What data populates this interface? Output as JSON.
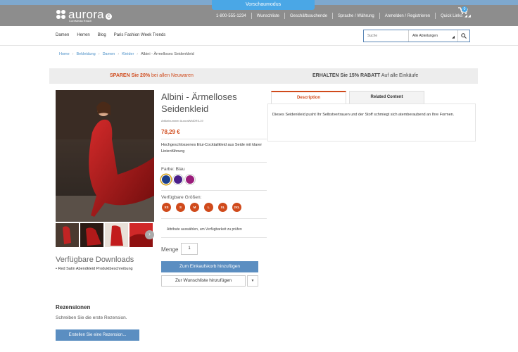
{
  "preview_bar": {
    "label": "Vorschaumodus"
  },
  "header": {
    "logo_text": "aurora",
    "logo_sub": "CoreMedia Reach",
    "phone": "1-800-555-1234",
    "links": [
      "Wunschliste",
      "Geschäftssuchende",
      "Sprache / Währung",
      "Anmelden / Registrieren",
      "Quick Links"
    ],
    "cart_count": "0"
  },
  "nav": {
    "items": [
      "Damen",
      "Herren",
      "Blog",
      "Paris Fashion Week Trends"
    ],
    "search_placeholder": "Suche",
    "department": "Alle Abteilungen"
  },
  "breadcrumb": [
    "Home",
    "Bekleidung",
    "Damen",
    "Kleider",
    "Albini - Ärmelloses Seidenkleid"
  ],
  "promo": {
    "left_bold": "SPAREN Sie 20%",
    "left_rest": " bei allen Neuwaren",
    "right_bold": "ERHALTEN Sie 15% RABATT",
    "right_rest": " Auf alle Einkäufe"
  },
  "product": {
    "name": "Albini - Ärmelloses Seidenkleid",
    "sku": "Artikelnummer AuroraWMDR5-19",
    "price": "78,29 €",
    "short_desc": "Hochgeschlossenes Etui-Cocktailkleid aus Seide mit klarer Linienführung",
    "color_label": "Farbe: Blau",
    "colors": [
      "#1c3f8c",
      "#4a1f8a",
      "#9a1c7a"
    ],
    "size_label": "Verfügbare Größen:",
    "sizes": [
      "XS",
      "S",
      "M",
      "L",
      "XL",
      "2XL"
    ],
    "attr_note": "Attribute auswählen, um Verfügbarkeit zu prüfen",
    "qty_label": "Menge",
    "qty_value": "1",
    "add_to_cart": "Zum Einkaufskorb hinzufügen",
    "wishlist": "Zur Wunschliste hinzufügen"
  },
  "tabs": {
    "description": "Description",
    "related": "Related Content",
    "description_text": "Dieses Seidenkleid pusht Ihr Selbstvertrauen und der Stoff schmiegt sich atemberaubend an Ihre Formen."
  },
  "downloads": {
    "title": "Verfügbare Downloads",
    "item": "Red Satin Abendkleid Produktbeschreibung"
  },
  "reviews": {
    "title": "Rezensionen",
    "text": "Schreiben Sie die erste Rezension.",
    "button": "Erstellen Sie eine Rezension..."
  }
}
